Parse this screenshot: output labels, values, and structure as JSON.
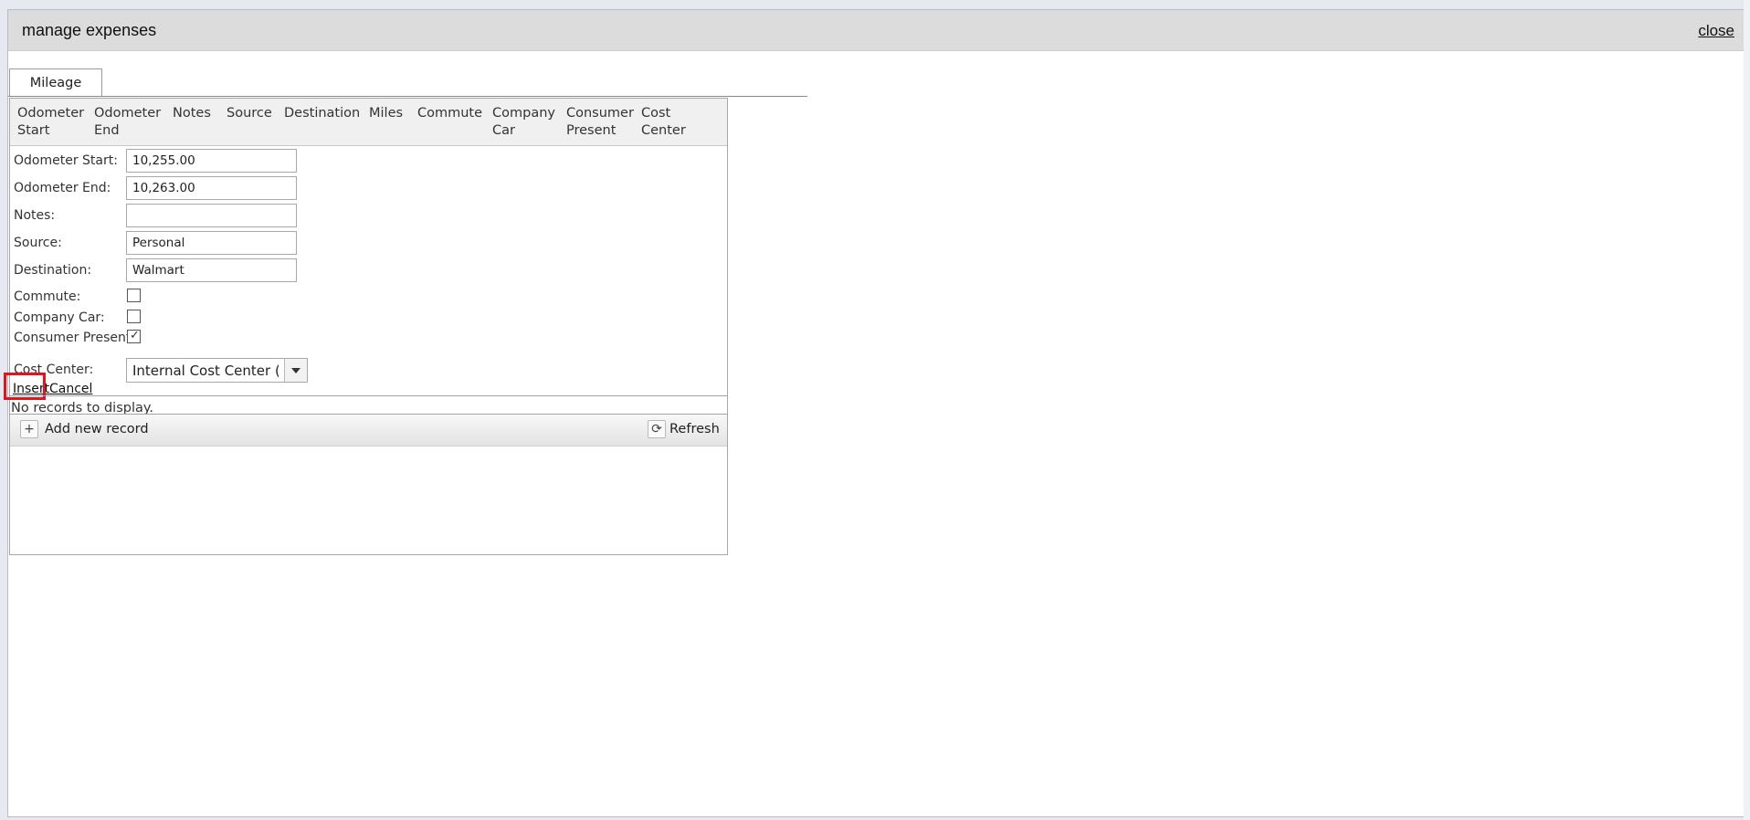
{
  "window": {
    "title": "manage expenses",
    "close_label": "close"
  },
  "tabs": [
    {
      "label": "Mileage",
      "selected": true
    }
  ],
  "grid": {
    "columns": [
      [
        "Odometer",
        "Start"
      ],
      [
        "Odometer",
        "End"
      ],
      [
        "Notes",
        ""
      ],
      [
        "Source",
        ""
      ],
      [
        "Destination",
        ""
      ],
      [
        "Miles",
        ""
      ],
      [
        "Commute",
        ""
      ],
      [
        "Company",
        "Car"
      ],
      [
        "Consumer",
        "Present"
      ],
      [
        "Cost",
        "Center"
      ]
    ],
    "no_records_text": "No records to display."
  },
  "form": {
    "odometer_start": {
      "label": "Odometer Start:",
      "value": "10,255.00"
    },
    "odometer_end": {
      "label": "Odometer End:",
      "value": "10,263.00"
    },
    "notes": {
      "label": "Notes:",
      "value": ""
    },
    "source": {
      "label": "Source:",
      "value": "Personal"
    },
    "destination": {
      "label": "Destination:",
      "value": "Walmart"
    },
    "commute": {
      "label": "Commute:",
      "checked": false
    },
    "company_car": {
      "label": "Company Car:",
      "checked": false
    },
    "consumer_present": {
      "label": "Consumer Present:",
      "checked": true
    },
    "cost_center": {
      "label": "Cost Center:",
      "value": "Internal Cost Center (CC"
    },
    "insert_label": "Insert",
    "cancel_label": "Cancel"
  },
  "command_bar": {
    "add_label": "Add new record",
    "add_icon": "plus-icon",
    "refresh_label": "Refresh",
    "refresh_icon": "refresh-icon"
  },
  "colors": {
    "highlight": "#e3141b",
    "titlebar": "#dcdcdc"
  }
}
